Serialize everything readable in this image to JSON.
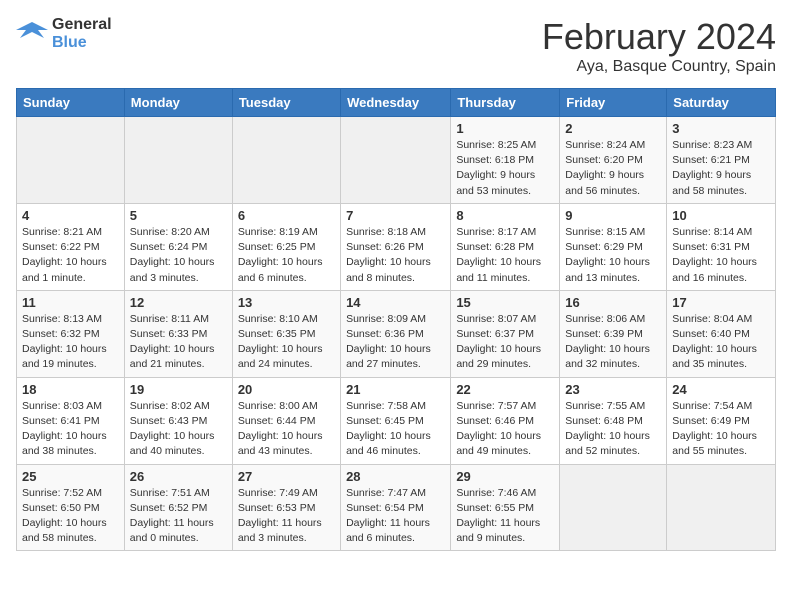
{
  "header": {
    "logo_general": "General",
    "logo_blue": "Blue",
    "month": "February 2024",
    "location": "Aya, Basque Country, Spain"
  },
  "weekdays": [
    "Sunday",
    "Monday",
    "Tuesday",
    "Wednesday",
    "Thursday",
    "Friday",
    "Saturday"
  ],
  "weeks": [
    [
      {
        "day": "",
        "info": ""
      },
      {
        "day": "",
        "info": ""
      },
      {
        "day": "",
        "info": ""
      },
      {
        "day": "",
        "info": ""
      },
      {
        "day": "1",
        "info": "Sunrise: 8:25 AM\nSunset: 6:18 PM\nDaylight: 9 hours\nand 53 minutes."
      },
      {
        "day": "2",
        "info": "Sunrise: 8:24 AM\nSunset: 6:20 PM\nDaylight: 9 hours\nand 56 minutes."
      },
      {
        "day": "3",
        "info": "Sunrise: 8:23 AM\nSunset: 6:21 PM\nDaylight: 9 hours\nand 58 minutes."
      }
    ],
    [
      {
        "day": "4",
        "info": "Sunrise: 8:21 AM\nSunset: 6:22 PM\nDaylight: 10 hours\nand 1 minute."
      },
      {
        "day": "5",
        "info": "Sunrise: 8:20 AM\nSunset: 6:24 PM\nDaylight: 10 hours\nand 3 minutes."
      },
      {
        "day": "6",
        "info": "Sunrise: 8:19 AM\nSunset: 6:25 PM\nDaylight: 10 hours\nand 6 minutes."
      },
      {
        "day": "7",
        "info": "Sunrise: 8:18 AM\nSunset: 6:26 PM\nDaylight: 10 hours\nand 8 minutes."
      },
      {
        "day": "8",
        "info": "Sunrise: 8:17 AM\nSunset: 6:28 PM\nDaylight: 10 hours\nand 11 minutes."
      },
      {
        "day": "9",
        "info": "Sunrise: 8:15 AM\nSunset: 6:29 PM\nDaylight: 10 hours\nand 13 minutes."
      },
      {
        "day": "10",
        "info": "Sunrise: 8:14 AM\nSunset: 6:31 PM\nDaylight: 10 hours\nand 16 minutes."
      }
    ],
    [
      {
        "day": "11",
        "info": "Sunrise: 8:13 AM\nSunset: 6:32 PM\nDaylight: 10 hours\nand 19 minutes."
      },
      {
        "day": "12",
        "info": "Sunrise: 8:11 AM\nSunset: 6:33 PM\nDaylight: 10 hours\nand 21 minutes."
      },
      {
        "day": "13",
        "info": "Sunrise: 8:10 AM\nSunset: 6:35 PM\nDaylight: 10 hours\nand 24 minutes."
      },
      {
        "day": "14",
        "info": "Sunrise: 8:09 AM\nSunset: 6:36 PM\nDaylight: 10 hours\nand 27 minutes."
      },
      {
        "day": "15",
        "info": "Sunrise: 8:07 AM\nSunset: 6:37 PM\nDaylight: 10 hours\nand 29 minutes."
      },
      {
        "day": "16",
        "info": "Sunrise: 8:06 AM\nSunset: 6:39 PM\nDaylight: 10 hours\nand 32 minutes."
      },
      {
        "day": "17",
        "info": "Sunrise: 8:04 AM\nSunset: 6:40 PM\nDaylight: 10 hours\nand 35 minutes."
      }
    ],
    [
      {
        "day": "18",
        "info": "Sunrise: 8:03 AM\nSunset: 6:41 PM\nDaylight: 10 hours\nand 38 minutes."
      },
      {
        "day": "19",
        "info": "Sunrise: 8:02 AM\nSunset: 6:43 PM\nDaylight: 10 hours\nand 40 minutes."
      },
      {
        "day": "20",
        "info": "Sunrise: 8:00 AM\nSunset: 6:44 PM\nDaylight: 10 hours\nand 43 minutes."
      },
      {
        "day": "21",
        "info": "Sunrise: 7:58 AM\nSunset: 6:45 PM\nDaylight: 10 hours\nand 46 minutes."
      },
      {
        "day": "22",
        "info": "Sunrise: 7:57 AM\nSunset: 6:46 PM\nDaylight: 10 hours\nand 49 minutes."
      },
      {
        "day": "23",
        "info": "Sunrise: 7:55 AM\nSunset: 6:48 PM\nDaylight: 10 hours\nand 52 minutes."
      },
      {
        "day": "24",
        "info": "Sunrise: 7:54 AM\nSunset: 6:49 PM\nDaylight: 10 hours\nand 55 minutes."
      }
    ],
    [
      {
        "day": "25",
        "info": "Sunrise: 7:52 AM\nSunset: 6:50 PM\nDaylight: 10 hours\nand 58 minutes."
      },
      {
        "day": "26",
        "info": "Sunrise: 7:51 AM\nSunset: 6:52 PM\nDaylight: 11 hours\nand 0 minutes."
      },
      {
        "day": "27",
        "info": "Sunrise: 7:49 AM\nSunset: 6:53 PM\nDaylight: 11 hours\nand 3 minutes."
      },
      {
        "day": "28",
        "info": "Sunrise: 7:47 AM\nSunset: 6:54 PM\nDaylight: 11 hours\nand 6 minutes."
      },
      {
        "day": "29",
        "info": "Sunrise: 7:46 AM\nSunset: 6:55 PM\nDaylight: 11 hours\nand 9 minutes."
      },
      {
        "day": "",
        "info": ""
      },
      {
        "day": "",
        "info": ""
      }
    ]
  ]
}
